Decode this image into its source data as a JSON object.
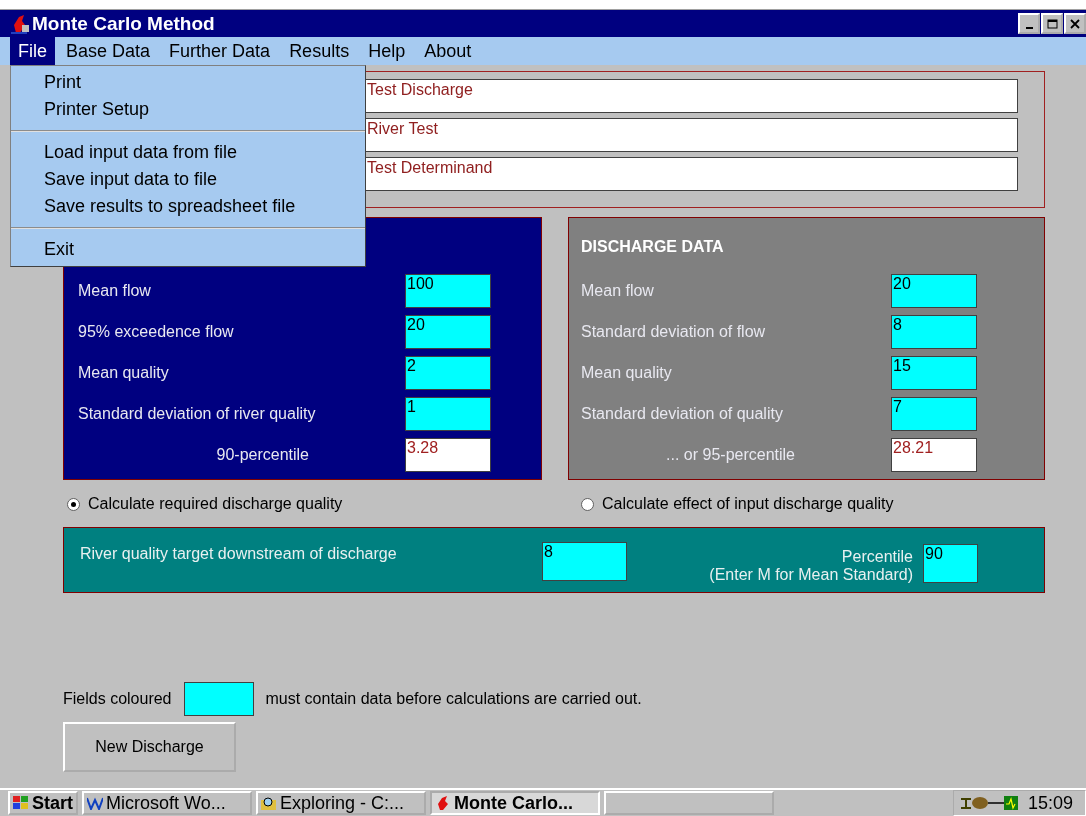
{
  "window": {
    "title": "Monte Carlo Method"
  },
  "menu_bar": [
    {
      "label": "File",
      "selected": true
    },
    {
      "label": "Base Data",
      "selected": false
    },
    {
      "label": "Further Data",
      "selected": false
    },
    {
      "label": "Results",
      "selected": false
    },
    {
      "label": "Help",
      "selected": false
    },
    {
      "label": "About",
      "selected": false
    }
  ],
  "file_menu": {
    "groups": [
      [
        "Print",
        "Printer Setup"
      ],
      [
        "Load input data from file",
        "Save input data to file",
        "Save results to spreadsheet file"
      ],
      [
        "Exit"
      ]
    ]
  },
  "name_fields": [
    "Test Discharge",
    "River Test",
    "Test Determinand"
  ],
  "river_data": {
    "rows": [
      {
        "label": "Mean flow",
        "value": "100",
        "kind": "required"
      },
      {
        "label": "95% exceedence flow",
        "value": "20",
        "kind": "required"
      },
      {
        "label": "Mean quality",
        "value": "2",
        "kind": "required"
      },
      {
        "label": "Standard deviation of river quality",
        "value": "1",
        "kind": "required"
      },
      {
        "label": "90-percentile",
        "value": "3.28",
        "kind": "result"
      }
    ]
  },
  "discharge_data": {
    "title": "DISCHARGE DATA",
    "rows": [
      {
        "label": "Mean flow",
        "value": "20",
        "kind": "required"
      },
      {
        "label": "Standard deviation of flow",
        "value": "8",
        "kind": "required"
      },
      {
        "label": "Mean quality",
        "value": "15",
        "kind": "required"
      },
      {
        "label": "Standard deviation of quality",
        "value": "7",
        "kind": "required"
      },
      {
        "label": "... or 95-percentile",
        "value": "28.21",
        "kind": "result"
      }
    ]
  },
  "modes": [
    {
      "label": "Calculate required discharge quality",
      "selected": true
    },
    {
      "label": "Calculate effect of input discharge quality",
      "selected": false
    }
  ],
  "target": {
    "label": "River quality target downstream of discharge",
    "value": "8",
    "percentile_label": "Percentile",
    "percentile_hint": "(Enter M for Mean Standard)",
    "percentile_value": "90"
  },
  "legend": {
    "before": "Fields coloured",
    "after": "must contain data before calculations are carried out."
  },
  "new_button": "New Discharge",
  "taskbar": {
    "start": "Start",
    "tasks": [
      {
        "label": "Microsoft Wo...",
        "selected": false
      },
      {
        "label": "Exploring - C:...",
        "selected": false
      },
      {
        "label": "Monte Carlo...",
        "selected": true
      }
    ],
    "clock": "15:09"
  }
}
